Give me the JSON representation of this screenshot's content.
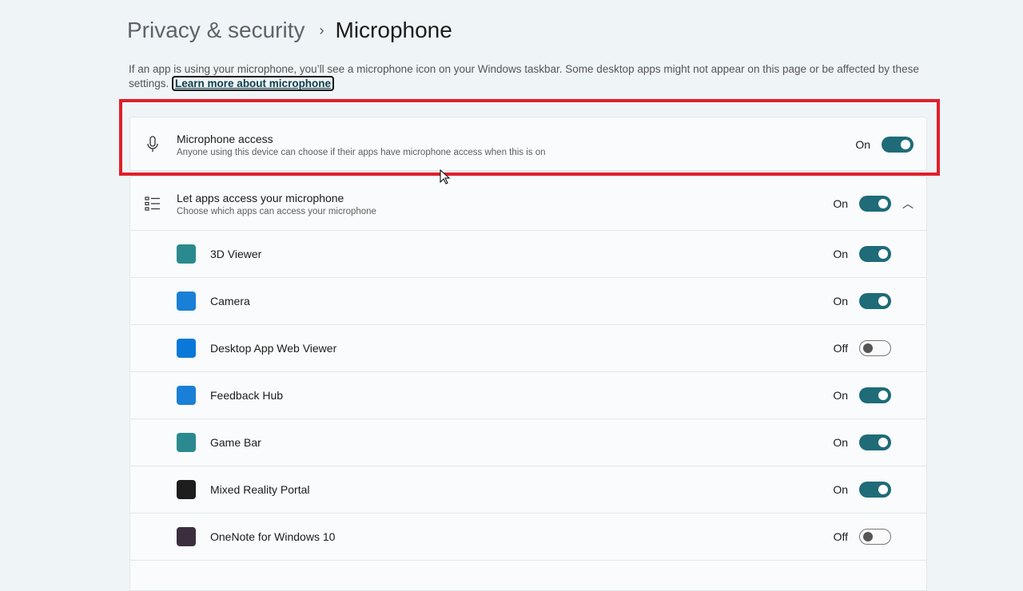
{
  "breadcrumb": {
    "parent": "Privacy & security",
    "separator": "›",
    "current": "Microphone"
  },
  "description": {
    "text": "If an app is using your microphone, you’ll see a microphone icon on your Windows taskbar. Some desktop apps might not appear on this page or be affected by these settings. ",
    "link": "Learn more about microphone"
  },
  "microphone_access": {
    "title": "Microphone access",
    "subtitle": "Anyone using this device can choose if their apps have microphone access when this is on",
    "state": "On",
    "icon": "microphone-icon"
  },
  "let_apps": {
    "title": "Let apps access your microphone",
    "subtitle": "Choose which apps can access your microphone",
    "state": "On",
    "icon": "list-icon"
  },
  "accent": "#1f6b78",
  "apps": [
    {
      "name": "3D Viewer",
      "state": "On",
      "on": true,
      "color": "#2a8a8f"
    },
    {
      "name": "Camera",
      "state": "On",
      "on": true,
      "color": "#1a7fd6"
    },
    {
      "name": "Desktop App Web Viewer",
      "state": "Off",
      "on": false,
      "color": "#0a78d8"
    },
    {
      "name": "Feedback Hub",
      "state": "On",
      "on": true,
      "color": "#1a7fd6"
    },
    {
      "name": "Game Bar",
      "state": "On",
      "on": true,
      "color": "#2a8a8f"
    },
    {
      "name": "Mixed Reality Portal",
      "state": "On",
      "on": true,
      "color": "#1d1d1d"
    },
    {
      "name": "OneNote for Windows 10",
      "state": "Off",
      "on": false,
      "color": "#3b2f3f"
    }
  ]
}
